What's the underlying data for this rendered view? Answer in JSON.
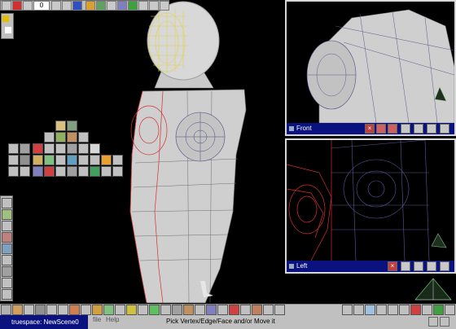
{
  "app": {
    "task_label": "truespace: NewScene0"
  },
  "menu": {
    "items": [
      "file",
      "Help"
    ]
  },
  "status": {
    "hint": "Pick Vertex/Edge/Face and/or Move it"
  },
  "top_toolbar": {
    "counter_value": "0"
  },
  "viewports": {
    "front": {
      "title": "Front"
    },
    "left": {
      "title": "Left"
    }
  }
}
